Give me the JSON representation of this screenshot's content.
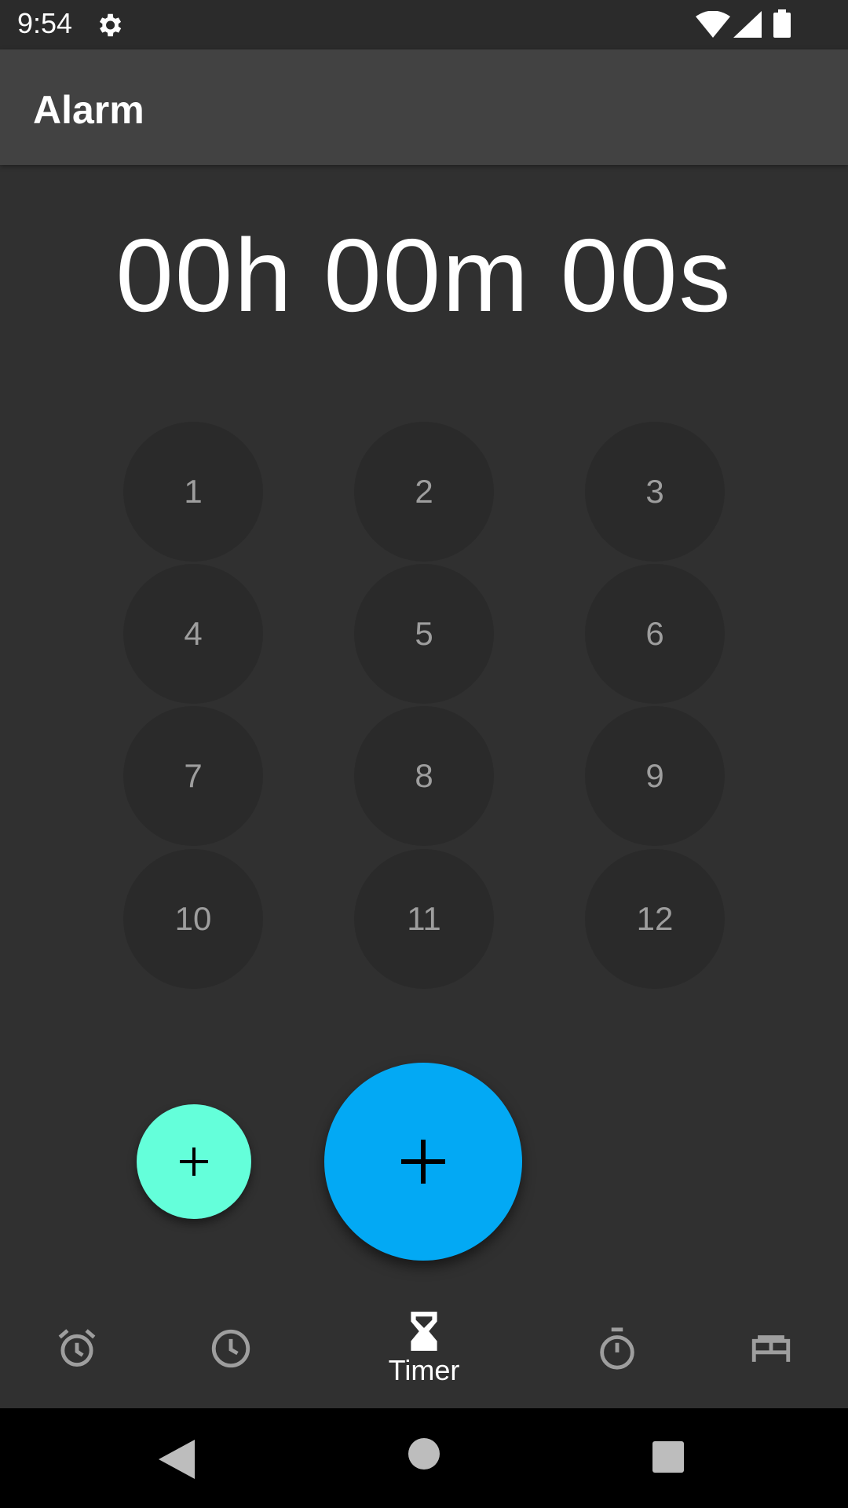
{
  "status_bar": {
    "time": "9:54",
    "icons": [
      "gear-icon",
      "wifi-icon",
      "signal-icon",
      "battery-icon"
    ]
  },
  "app_bar": {
    "title": "Alarm"
  },
  "timer": {
    "display": "00h 00m 00s"
  },
  "keypad": {
    "keys": [
      "1",
      "2",
      "3",
      "4",
      "5",
      "6",
      "7",
      "8",
      "9",
      "10",
      "11",
      "12"
    ]
  },
  "fabs": {
    "small_icon": "plus-icon",
    "large_icon": "plus-icon",
    "small_color": "#64ffda",
    "large_color": "#03a9f4"
  },
  "bottom_nav": {
    "items": [
      {
        "icon": "alarm-icon",
        "label": ""
      },
      {
        "icon": "clock-icon",
        "label": ""
      },
      {
        "icon": "hourglass-icon",
        "label": "Timer"
      },
      {
        "icon": "stopwatch-icon",
        "label": ""
      },
      {
        "icon": "bed-icon",
        "label": ""
      }
    ],
    "active_index": 2
  },
  "colors": {
    "background": "#303030",
    "app_bar": "#424242",
    "key_background": "#2a2a2a",
    "key_text": "#9e9e9e"
  }
}
